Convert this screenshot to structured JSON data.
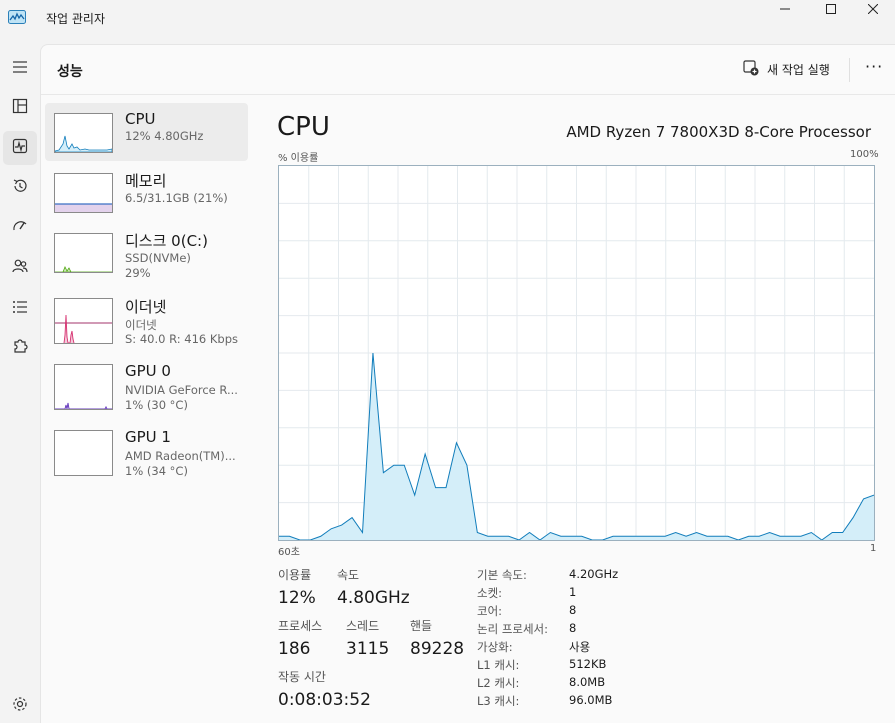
{
  "app": {
    "title": "작업 관리자"
  },
  "header": {
    "title": "성능",
    "run_task_label": "새 작업 실행",
    "more_label": "···"
  },
  "devices": [
    {
      "name": "CPU",
      "sub1": "12% 4.80GHz",
      "sub2": "",
      "color": "#117dbb"
    },
    {
      "name": "메모리",
      "sub1": "6.5/31.1GB (21%)",
      "sub2": "",
      "color": "#8b12ae"
    },
    {
      "name": "디스크 0(C:)",
      "sub1": "SSD(NVMe)",
      "sub2": "29%",
      "color": "#4da60c"
    },
    {
      "name": "이더넷",
      "sub1": "이더넷",
      "sub2": "S: 40.0  R: 416 Kbps",
      "color": "#a74f01"
    },
    {
      "name": "GPU 0",
      "sub1": "NVIDIA GeForce R...",
      "sub2": "1% (30 °C)",
      "color": "#ac3c4a"
    },
    {
      "name": "GPU 1",
      "sub1": "AMD Radeon(TM)...",
      "sub2": "1% (34 °C)",
      "color": "#ac3c4a"
    }
  ],
  "detail": {
    "title": "CPU",
    "processor": "AMD Ryzen 7 7800X3D 8-Core Processor",
    "y_label": "% 이용률",
    "y_max_label": "100%",
    "x_left_label": "60초",
    "x_right_label": "1"
  },
  "chart_data": {
    "type": "area",
    "title": "",
    "xlabel": "",
    "ylabel": "% 이용률",
    "x_range_seconds": [
      60,
      0
    ],
    "ylim": [
      0,
      100
    ],
    "grid": true,
    "color": "#117dbb",
    "fill": "#d4eef9",
    "values": [
      1,
      1,
      0,
      0,
      1,
      3,
      4,
      6,
      2,
      50,
      18,
      20,
      20,
      12,
      23,
      14,
      14,
      26,
      20,
      2,
      1,
      1,
      1,
      0,
      2,
      0,
      2,
      1,
      1,
      1,
      0,
      0,
      1,
      1,
      1,
      1,
      1,
      1,
      2,
      1,
      2,
      1,
      1,
      1,
      0,
      1,
      1,
      2,
      1,
      1,
      1,
      2,
      0,
      2,
      2,
      6,
      11,
      12
    ]
  },
  "stats": {
    "utilization": {
      "label": "이용률",
      "value": "12%"
    },
    "speed": {
      "label": "속도",
      "value": "4.80GHz"
    },
    "processes": {
      "label": "프로세스",
      "value": "186"
    },
    "threads": {
      "label": "스레드",
      "value": "3115"
    },
    "handles": {
      "label": "핸들",
      "value": "89228"
    },
    "uptime": {
      "label": "작동 시간",
      "value": "0:08:03:52"
    }
  },
  "specs": [
    {
      "label": "기본 속도:",
      "value": "4.20GHz"
    },
    {
      "label": "소켓:",
      "value": "1"
    },
    {
      "label": "코어:",
      "value": "8"
    },
    {
      "label": "논리 프로세서:",
      "value": "8"
    },
    {
      "label": "가상화:",
      "value": "사용"
    },
    {
      "label": "L1 캐시:",
      "value": "512KB"
    },
    {
      "label": "L2 캐시:",
      "value": "8.0MB"
    },
    {
      "label": "L3 캐시:",
      "value": "96.0MB"
    }
  ]
}
